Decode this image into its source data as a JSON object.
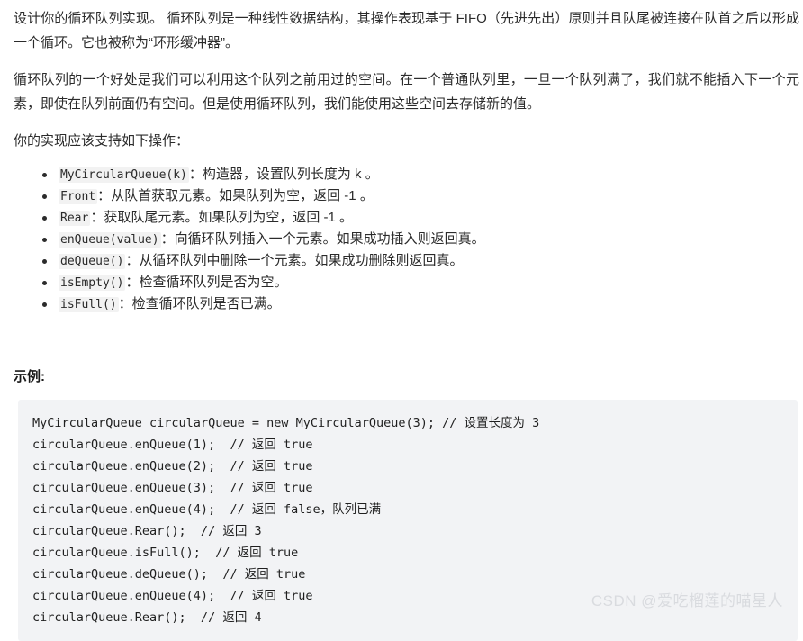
{
  "article": {
    "paragraphs": [
      "设计你的循环队列实现。 循环队列是一种线性数据结构，其操作表现基于 FIFO（先进先出）原则并且队尾被连接在队首之后以形成一个循环。它也被称为“环形缓冲器”。",
      "循环队列的一个好处是我们可以利用这个队列之前用过的空间。在一个普通队列里，一旦一个队列满了，我们就不能插入下一个元素，即使在队列前面仍有空间。但是使用循环队列，我们能使用这些空间去存储新的值。",
      "你的实现应该支持如下操作："
    ],
    "operations": [
      {
        "code": "MyCircularQueue(k)",
        "desc": "：构造器，设置队列长度为 k 。"
      },
      {
        "code": "Front",
        "desc": "：从队首获取元素。如果队列为空，返回 -1 。"
      },
      {
        "code": "Rear",
        "desc": "：获取队尾元素。如果队列为空，返回 -1 。"
      },
      {
        "code": "enQueue(value)",
        "desc": "：向循环队列插入一个元素。如果成功插入则返回真。"
      },
      {
        "code": "deQueue()",
        "desc": "：从循环队列中删除一个元素。如果成功删除则返回真。"
      },
      {
        "code": "isEmpty()",
        "desc": "：检查循环队列是否为空。"
      },
      {
        "code": "isFull()",
        "desc": "：检查循环队列是否已满。"
      }
    ],
    "example_title": "示例:",
    "code_block": {
      "lines": [
        "MyCircularQueue circularQueue = new MyCircularQueue(3); // 设置长度为 3",
        "circularQueue.enQueue(1);  // 返回 true",
        "circularQueue.enQueue(2);  // 返回 true",
        "circularQueue.enQueue(3);  // 返回 true",
        "circularQueue.enQueue(4);  // 返回 false，队列已满",
        "circularQueue.Rear();  // 返回 3",
        "circularQueue.isFull();  // 返回 true",
        "circularQueue.deQueue();  // 返回 true",
        "circularQueue.enQueue(4);  // 返回 true",
        "circularQueue.Rear();  // 返回 4"
      ]
    }
  },
  "watermark": {
    "text": "CSDN @爱吃榴莲的喵星人"
  },
  "colors": {
    "code_block_bg": "#f2f3f5",
    "inline_code_bg": "#f2f2f2",
    "text": "#2b2b2b",
    "watermark": "#d9dbdf"
  }
}
